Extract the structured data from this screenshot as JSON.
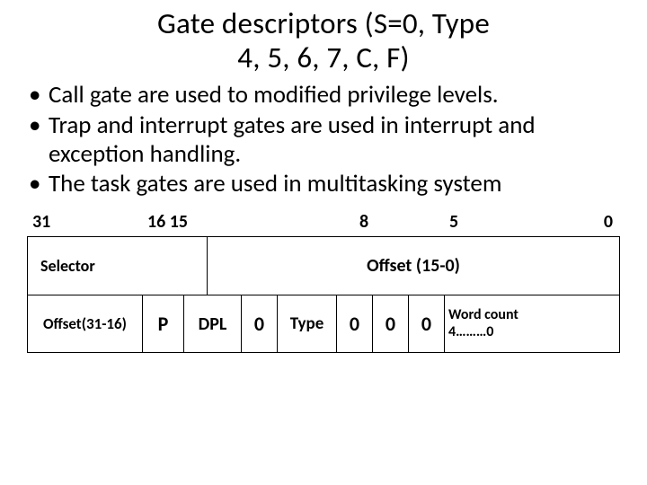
{
  "title_line1": "Gate descriptors (S=0, Type",
  "title_line2": "4, 5, 6, 7, C, F)",
  "bullets": {
    "b0": "Call gate are used to modified privilege levels.",
    "b1": "Trap and interrupt gates are used in interrupt and exception handling.",
    "b2": "The task gates are used in multitasking system"
  },
  "bits": {
    "b31": "31",
    "b1615": "16 15",
    "b8": "8",
    "b5": "5",
    "b0": "0"
  },
  "row1": {
    "selector": "Selector",
    "offset150": "Offset (15-0)"
  },
  "row2": {
    "off3116": "Offset(31-16)",
    "p": "P",
    "dpl": "DPL",
    "z1": "0",
    "type": "Type",
    "z2": "0",
    "z3": "0",
    "z4": "0",
    "wc_line1": "Word count",
    "wc_line2": "4………0"
  }
}
